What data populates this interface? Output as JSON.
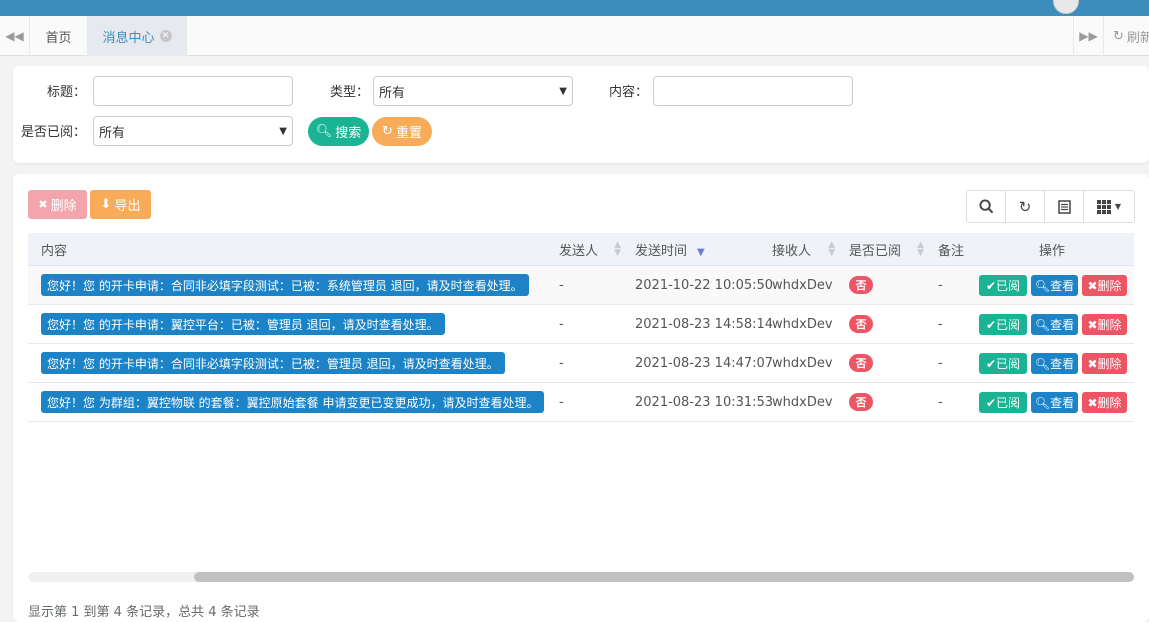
{
  "tabs": {
    "home_label": "首页",
    "active_label": "消息中心",
    "close_glyph": "✕",
    "refresh_label": "刷新"
  },
  "search_form": {
    "title_label": "标题：",
    "title_value": "",
    "type_label": "类型：",
    "type_value": "所有",
    "content_label": "内容：",
    "content_value": "",
    "read_label": "是否已阅：",
    "read_value": "所有",
    "search_button": "搜索",
    "reset_button": "重置"
  },
  "toolbar": {
    "delete_label": "删除",
    "export_label": "导出"
  },
  "table": {
    "columns": [
      "内容",
      "发送人",
      "发送时间",
      "接收人",
      "是否已阅",
      "备注",
      "操作"
    ],
    "rows": [
      {
        "content": "您好！您 的开卡申请：合同非必填字段测试：已被：系统管理员 退回，请及时查看处理。",
        "sender": "-",
        "time": "2021-10-22 10:05:50",
        "receiver": "whdxDev",
        "read": "否",
        "remark": "-"
      },
      {
        "content": "您好！您 的开卡申请：翼控平台：已被：管理员 退回，请及时查看处理。",
        "sender": "-",
        "time": "2021-08-23 14:58:14",
        "receiver": "whdxDev",
        "read": "否",
        "remark": "-"
      },
      {
        "content": "您好！您 的开卡申请：合同非必填字段测试：已被：管理员 退回，请及时查看处理。",
        "sender": "-",
        "time": "2021-08-23 14:47:07",
        "receiver": "whdxDev",
        "read": "否",
        "remark": "-"
      },
      {
        "content": "您好！您 为群组：翼控物联 的套餐：翼控原始套餐 申请变更已变更成功，请及时查看处理。",
        "sender": "-",
        "time": "2021-08-23 10:31:53",
        "receiver": "whdxDev",
        "read": "否",
        "remark": "-"
      }
    ],
    "actions": {
      "read": "已阅",
      "view": "查看",
      "delete": "删除"
    }
  },
  "pagination": {
    "info": "显示第 1 到第 4 条记录，总共 4 条记录"
  },
  "colors": {
    "topbar": "#3c8dbc",
    "primary": "#1c84c6",
    "success": "#1ab394",
    "warning": "#f8ac59",
    "danger": "#ed5565"
  },
  "icons": {
    "back": "backward-icon",
    "forward": "forward-icon",
    "refresh": "refresh-icon",
    "search": "search-icon",
    "reset": "refresh-icon",
    "delete": "times-icon",
    "export": "download-icon",
    "toggle": "list-icon",
    "columns": "grid-icon",
    "check": "check-icon",
    "view": "search-icon"
  }
}
